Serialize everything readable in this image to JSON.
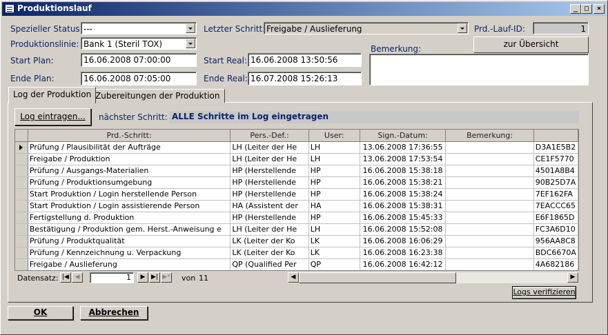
{
  "window": {
    "title": "Produktionslauf",
    "min": "_",
    "max": "□",
    "close": "×"
  },
  "form": {
    "spezieller_status_label": "Spezieller Status:",
    "spezieller_status_value": "---",
    "produktionslinie_label": "Produktionslinie:",
    "produktionslinie_value": "Bank 1 (Steril TOX)",
    "start_plan_label": "Start Plan:",
    "start_plan_value": "16.06.2008 07:00:00",
    "ende_plan_label": "Ende Plan:",
    "ende_plan_value": "16.06.2008 07:05:00",
    "letzter_schritt_label": "Letzter Schritt:",
    "letzter_schritt_value": "Freigabe / Auslieferung",
    "start_real_label": "Start Real:",
    "start_real_value": "16.06.2008 13:50:56",
    "ende_real_label": "Ende Real:",
    "ende_real_value": "16.07.2008 15:26:13",
    "lauf_id_label": "Prd.-Lauf-ID:",
    "lauf_id_value": "1",
    "bemerkung_label": "Bemerkung:",
    "bemerkung_value": "",
    "overview_button": "zur Übersicht"
  },
  "tabs": [
    {
      "label": "Log der Produktion",
      "active": true
    },
    {
      "label": "Zubereitungen der Produktion",
      "active": false
    }
  ],
  "log": {
    "log_button": "Log eintragen...",
    "next_step_label": "nächster Schritt:",
    "next_step_value": "ALLE Schritte im Log eingetragen",
    "columns": [
      "Prd.-Schritt:",
      "Pers.-Def.:",
      "User:",
      "Sign.-Datum:",
      "Bemerkung:",
      ""
    ],
    "rows": [
      [
        "Prüfung / Plausibilität der Aufträge",
        "LH (Leiter der He",
        "LH",
        "13.06.2008 17:36:55",
        "",
        "D3A1E5B2"
      ],
      [
        "Freigabe / Produktion",
        "LH (Leiter der He",
        "LH",
        "13.06.2008 17:53:54",
        "",
        "CE1F5770"
      ],
      [
        "Prüfung / Ausgangs-Materialien",
        "HP (Herstellende",
        "HP",
        "16.06.2008 15:38:18",
        "",
        "4501A8B4"
      ],
      [
        "Prüfung / Produktionsumgebung",
        "HP (Herstellende",
        "HP",
        "16.06.2008 15:38:21",
        "",
        "90B25D7A"
      ],
      [
        "Start Produktion / Login herstellende Person",
        "HP (Herstellende",
        "HP",
        "16.06.2008 15:38:24",
        "",
        "7EF162FA"
      ],
      [
        "Start Produktion / Login assistierende Person",
        "HA (Assistent der",
        "HA",
        "16.06.2008 15:38:31",
        "",
        "7EACCC65"
      ],
      [
        "Fertigstellung d. Produktion",
        "HP (Herstellende",
        "HP",
        "16.06.2008 15:45:33",
        "",
        "E6F1865D"
      ],
      [
        "Bestätigung / Produktion gem. Herst.-Anweisung e",
        "LH (Leiter der He",
        "LH",
        "16.06.2008 15:52:08",
        "",
        "FC3A6D10"
      ],
      [
        "Prüfung / Produktqualität",
        "LK (Leiter der Ko",
        "LK",
        "16.06.2008 16:06:29",
        "",
        "956AA8C8"
      ],
      [
        "Prüfung / Kennzeichnung u. Verpackung",
        "LK (Leiter der Ko",
        "LK",
        "16.06.2008 16:23:38",
        "",
        "BDC6670A"
      ],
      [
        "Freigabe / Auslieferung",
        "QP (Qualified Per",
        "QP",
        "16.06.2008 16:42:12",
        "",
        "4A682186"
      ]
    ],
    "nav": {
      "label": "Datensatz:",
      "current": "1",
      "of_label": "von",
      "total": "11"
    },
    "verify_button": "Logs verifizieren"
  },
  "footer": {
    "ok": "OK",
    "cancel": "Abbrechen"
  }
}
